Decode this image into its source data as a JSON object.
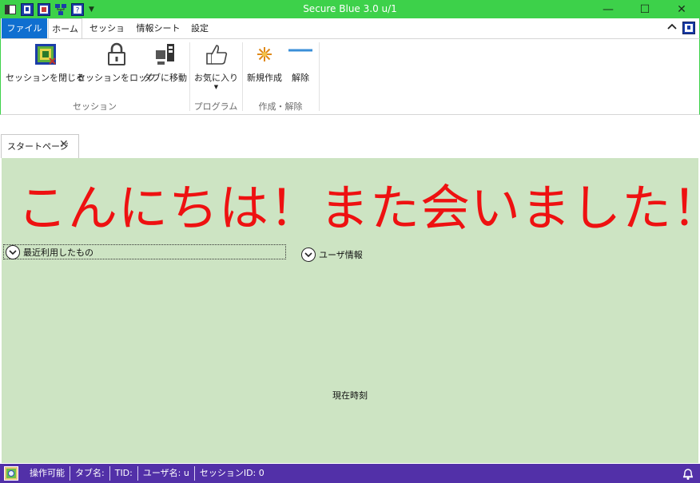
{
  "window": {
    "title": "Secure Blue 3.0 u/1",
    "minimize_icon": "—",
    "maximize_icon": "☐",
    "close_icon": "✕"
  },
  "ribbon_tabs": [
    "ファイル",
    "ホーム",
    "セッション",
    "情報シート",
    "設定"
  ],
  "ribbon": {
    "buttons": {
      "close_session": "セッションを閉じる",
      "lock_session": "セッションをロック",
      "move_to_tab": "タブに移動",
      "favorites": "お気に入り",
      "create_new": "新規作成",
      "release": "解除"
    },
    "groups": {
      "session": "セッション",
      "program": "プログラム",
      "create_release": "作成・解除"
    }
  },
  "doc_tab": {
    "label": "スタートページ"
  },
  "start_page": {
    "greeting": "こんにちは！また会いました！",
    "recent_label": "最近利用したもの",
    "user_info_label": "ユーザ情報",
    "current_time_label": "現在時刻"
  },
  "status": {
    "state": "操作可能",
    "tab_name": "タブ名:",
    "tid": "TID:",
    "user_name": "ユーザ名:  u",
    "session_id": "セッションID:  0"
  },
  "colors": {
    "titlebar": "#3dd14a",
    "file_tab": "#0f6fd0",
    "content_bg": "#cde4c3",
    "greeting": "#ee1111",
    "statusbar": "#5230a8"
  }
}
